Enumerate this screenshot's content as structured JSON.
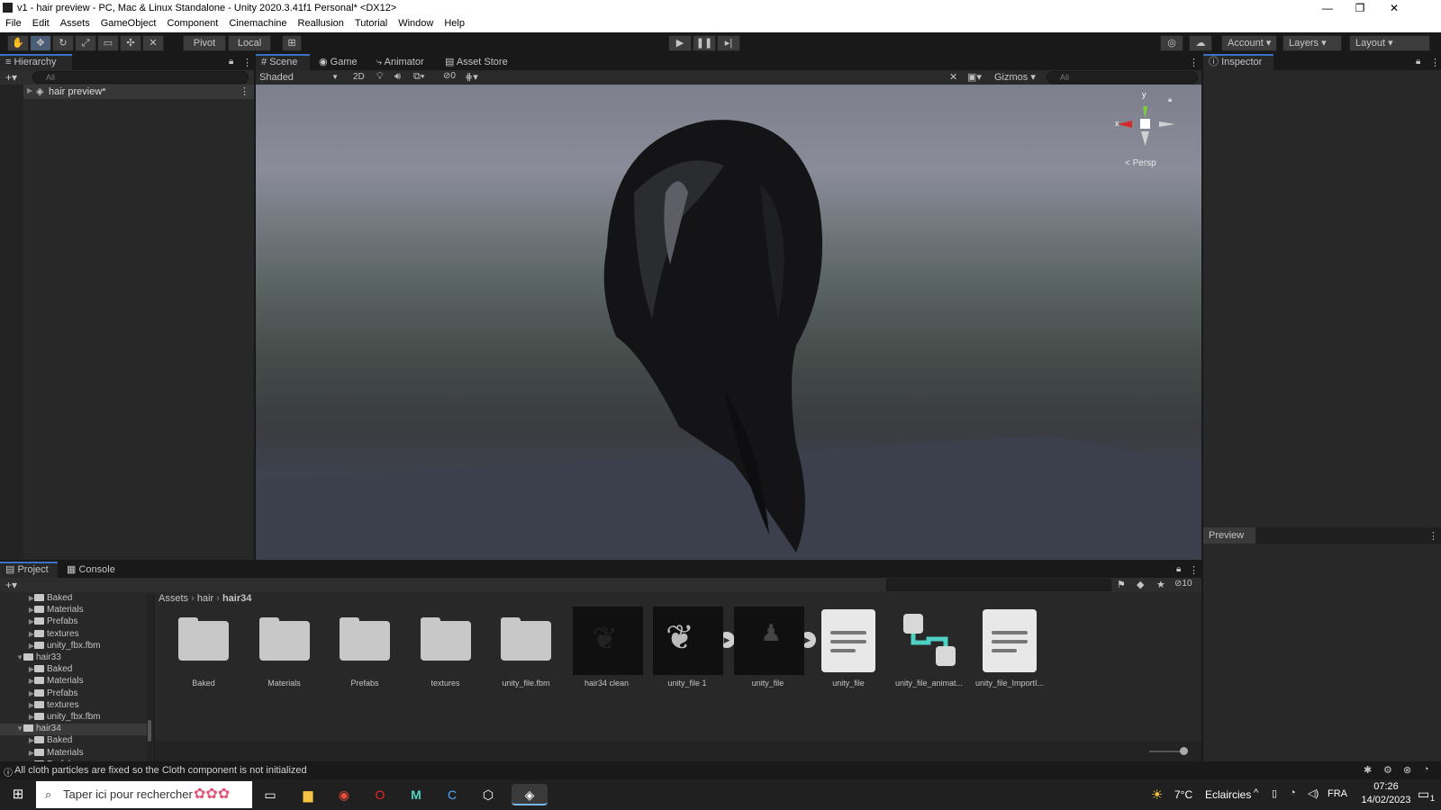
{
  "window": {
    "title": "v1 - hair preview - PC, Mac & Linux Standalone - Unity 2020.3.41f1 Personal* <DX12>",
    "minimize": "—",
    "restore": "❐",
    "close": "✕"
  },
  "menu": [
    "File",
    "Edit",
    "Assets",
    "GameObject",
    "Component",
    "Cinemachine",
    "Reallusion",
    "Tutorial",
    "Window",
    "Help"
  ],
  "toolbar": {
    "pivot": "Pivot",
    "local": "Local",
    "account": "Account",
    "layers": "Layers",
    "layout": "Layout"
  },
  "hierarchy": {
    "tab": "Hierarchy",
    "search_placeholder": "All",
    "scene": "hair preview*"
  },
  "scene": {
    "tabs": [
      "Scene",
      "Game",
      "Animator",
      "Asset Store"
    ],
    "shading": "Shaded",
    "mode_2d": "2D",
    "hidden_count": "0",
    "gizmos": "Gizmos",
    "search_placeholder": "All",
    "axis_y": "y",
    "axis_x": "x",
    "persp": "< Persp"
  },
  "inspector": {
    "tab": "Inspector",
    "preview": "Preview"
  },
  "project": {
    "tabs": [
      "Project",
      "Console"
    ],
    "layer_count": "10",
    "breadcrumb": [
      "Assets",
      "hair",
      "hair34"
    ],
    "tree": [
      {
        "label": "Baked",
        "depth": 2,
        "folder": true,
        "expanded": false
      },
      {
        "label": "Materials",
        "depth": 2,
        "folder": true,
        "expanded": false
      },
      {
        "label": "Prefabs",
        "depth": 2,
        "folder": true,
        "expanded": false
      },
      {
        "label": "textures",
        "depth": 2,
        "folder": true,
        "expanded": false
      },
      {
        "label": "unity_fbx.fbm",
        "depth": 2,
        "folder": true,
        "expanded": false
      },
      {
        "label": "hair33",
        "depth": 1,
        "folder": true,
        "expanded": true
      },
      {
        "label": "Baked",
        "depth": 2,
        "folder": true,
        "expanded": false
      },
      {
        "label": "Materials",
        "depth": 2,
        "folder": true,
        "expanded": false
      },
      {
        "label": "Prefabs",
        "depth": 2,
        "folder": true,
        "expanded": false
      },
      {
        "label": "textures",
        "depth": 2,
        "folder": true,
        "expanded": false
      },
      {
        "label": "unity_fbx.fbm",
        "depth": 2,
        "folder": true,
        "expanded": false
      },
      {
        "label": "hair34",
        "depth": 1,
        "folder": true,
        "expanded": true,
        "selected": true
      },
      {
        "label": "Baked",
        "depth": 2,
        "folder": true,
        "expanded": false
      },
      {
        "label": "Materials",
        "depth": 2,
        "folder": true,
        "expanded": false
      },
      {
        "label": "Prefabs",
        "depth": 2,
        "folder": true,
        "expanded": false
      }
    ],
    "assets": [
      {
        "label": "Baked",
        "kind": "folder"
      },
      {
        "label": "Materials",
        "kind": "folder"
      },
      {
        "label": "Prefabs",
        "kind": "folder"
      },
      {
        "label": "textures",
        "kind": "folder"
      },
      {
        "label": "unity_file.fbm",
        "kind": "folder"
      },
      {
        "label": "hair34 clean",
        "kind": "dark-thumb"
      },
      {
        "label": "unity_file 1",
        "kind": "model"
      },
      {
        "label": "unity_file",
        "kind": "model"
      },
      {
        "label": "unity_file",
        "kind": "doc"
      },
      {
        "label": "unity_file_animat...",
        "kind": "animator"
      },
      {
        "label": "unity_file_ImportI...",
        "kind": "doc"
      }
    ]
  },
  "status": {
    "message": "All cloth particles are fixed so the Cloth component is not initialized"
  },
  "taskbar": {
    "search_placeholder": "Taper ici pour rechercher",
    "weather_temp": "7°C",
    "weather_text": "Eclaircies",
    "lang": "FRA",
    "time": "07:26",
    "date": "14/02/2023",
    "notification_count": "1"
  },
  "colors": {
    "accent": "#3a72c4",
    "panel": "#282828",
    "toolbar": "#191919"
  }
}
